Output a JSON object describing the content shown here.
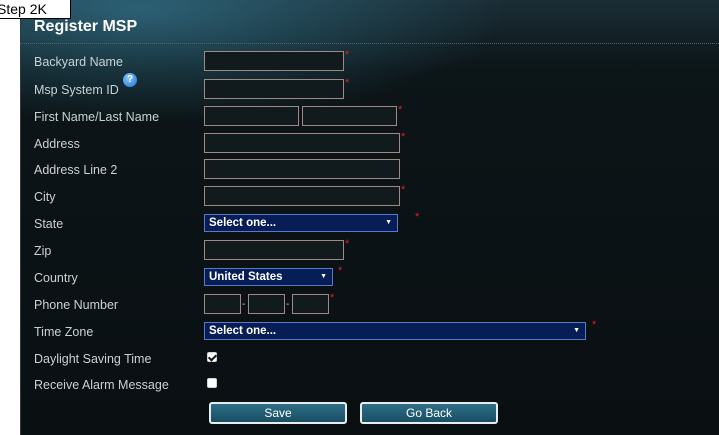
{
  "step_tag": "Step 2K",
  "title": "Register MSP",
  "fields": {
    "backyard_name": "Backyard Name",
    "msp_system_id": "Msp System ID",
    "name": "First Name/Last Name",
    "address": "Address",
    "address2": "Address Line 2",
    "city": "City",
    "state": "State",
    "zip": "Zip",
    "country": "Country",
    "phone": "Phone Number",
    "timezone": "Time Zone",
    "dst": "Daylight Saving Time",
    "alarm": "Receive Alarm Message"
  },
  "required_mark": "*",
  "help_icon": "?",
  "phone_separator": "-",
  "selects": {
    "state": "Select one...",
    "country": "United States",
    "timezone": "Select one..."
  },
  "select_arrow": "▼",
  "checkboxes": {
    "dst": true,
    "alarm": false
  },
  "buttons": {
    "save": "Save",
    "go_back": "Go Back"
  }
}
